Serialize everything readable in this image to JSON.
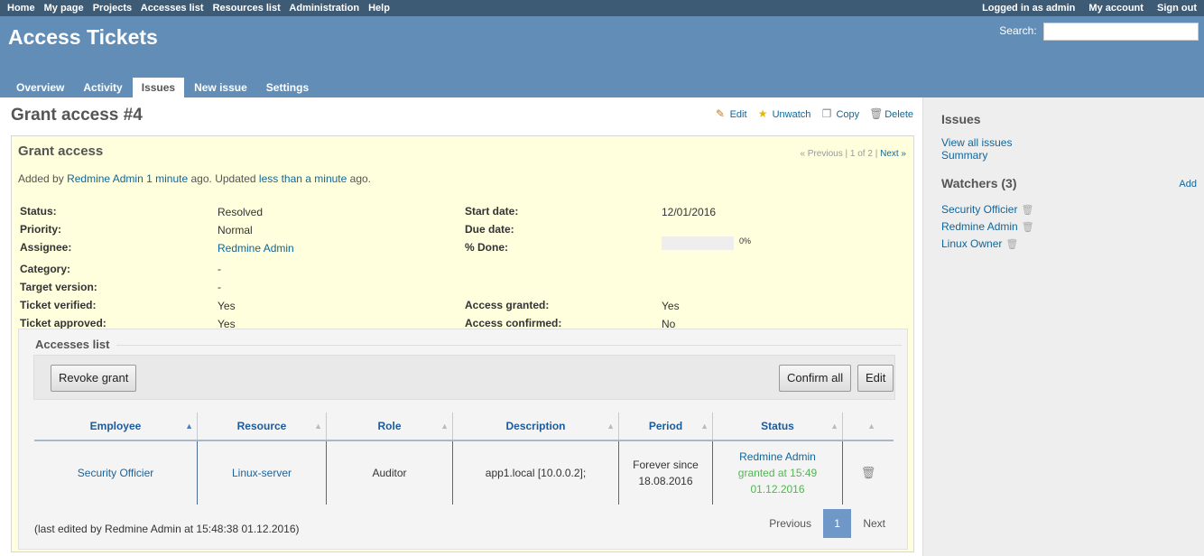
{
  "top_menu": {
    "items": [
      "Home",
      "My page",
      "Projects",
      "Accesses list",
      "Resources list",
      "Administration",
      "Help"
    ],
    "logged_in": "Logged in as admin",
    "my_account": "My account",
    "sign_out": "Sign out"
  },
  "header": {
    "title": "Access Tickets",
    "search_label": "Search:",
    "search_value": ""
  },
  "main_menu": {
    "tabs": [
      {
        "label": "Overview"
      },
      {
        "label": "Activity"
      },
      {
        "label": "Issues",
        "selected": true
      },
      {
        "label": "New issue"
      },
      {
        "label": "Settings"
      }
    ]
  },
  "issue": {
    "title": "Grant access #4",
    "actions": {
      "edit": "Edit",
      "unwatch": "Unwatch",
      "copy": "Copy",
      "delete": "Delete"
    },
    "subject": "Grant access",
    "prev_next": {
      "previous": "« Previous",
      "sep1": "|",
      "position": "1 of 2",
      "sep2": "|",
      "next": "Next »"
    },
    "author": {
      "prefix": "Added by",
      "author_name": "Redmine Admin",
      "added_ago": "1 minute",
      "mid": "ago. Updated",
      "updated_ago": "less than a minute",
      "suffix": "ago."
    },
    "attributes": {
      "status_label": "Status:",
      "status": "Resolved",
      "priority_label": "Priority:",
      "priority": "Normal",
      "assignee_label": "Assignee:",
      "assignee": "Redmine Admin",
      "category_label": "Category:",
      "category": "-",
      "target_version_label": "Target version:",
      "target_version": "-",
      "ticket_verified_label": "Ticket verified:",
      "ticket_verified": "Yes",
      "ticket_approved_label": "Ticket approved:",
      "ticket_approved": "Yes",
      "start_date_label": "Start date:",
      "start_date": "12/01/2016",
      "due_date_label": "Due date:",
      "due_date": "",
      "done_label": "% Done:",
      "done_text": "0%",
      "done_fraction": 0,
      "access_granted_label": "Access granted:",
      "access_granted": "Yes",
      "access_confirmed_label": "Access confirmed:",
      "access_confirmed": "No"
    }
  },
  "accesses": {
    "legend": "Accesses list",
    "revoke_button": "Revoke grant",
    "confirm_all_button": "Confirm all",
    "edit_button": "Edit",
    "columns": [
      "Employee",
      "Resource",
      "Role",
      "Description",
      "Period",
      "Status",
      ""
    ],
    "row": {
      "employee": "Security Officier",
      "resource": "Linux-server",
      "role": "Auditor",
      "description": "app1.local [10.0.0.2];",
      "period_line1": "Forever since",
      "period_line2": "18.08.2016",
      "status_user": "Redmine Admin",
      "status_line2": "granted at 15:49",
      "status_line3": "01.12.2016"
    },
    "last_edited": "(last edited by Redmine Admin at 15:48:38 01.12.2016)",
    "pager": {
      "previous": "Previous",
      "current": "1",
      "next": "Next"
    }
  },
  "sidebar": {
    "issues_heading": "Issues",
    "view_all": "View all issues",
    "summary": "Summary",
    "watchers_heading": "Watchers (3)",
    "add": "Add",
    "watchers": [
      "Security Officier",
      "Redmine Admin",
      "Linux Owner"
    ]
  },
  "colors": {
    "header_bg": "#628db6",
    "top_menu_bg": "#3e5b76",
    "issue_bg": "#ffffdd",
    "link": "#169",
    "granted_green": "#51b651",
    "pager_current": "#6f98c8"
  }
}
